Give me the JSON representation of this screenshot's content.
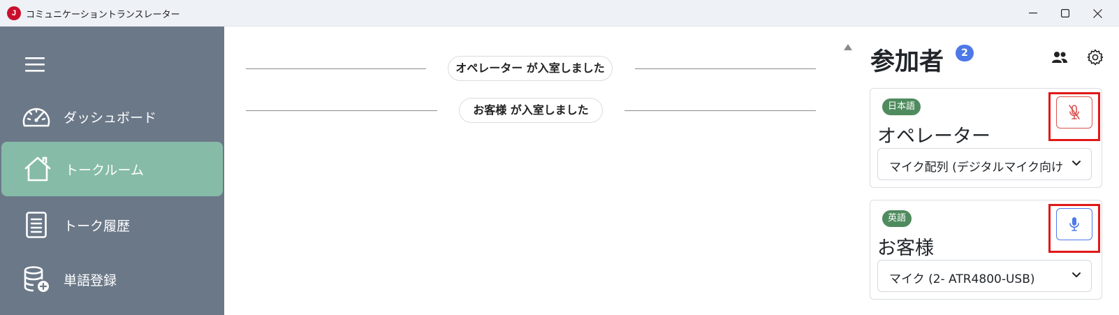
{
  "window": {
    "title": "コミュニケーショントランスレーター",
    "logo_text": "J"
  },
  "sidebar": {
    "items": [
      {
        "label": "ダッシュボード",
        "icon": "gauge-icon",
        "active": false
      },
      {
        "label": "トークルーム",
        "icon": "home-icon",
        "active": true
      },
      {
        "label": "トーク履歴",
        "icon": "document-icon",
        "active": false
      },
      {
        "label": "単語登録",
        "icon": "database-add-icon",
        "active": false
      }
    ],
    "active_color": "#86bba8",
    "background": "#6b7888"
  },
  "chat": {
    "system_messages": [
      {
        "text": "オペレーター が入室しました"
      },
      {
        "text": "お客様 が入室しました"
      }
    ]
  },
  "participants": {
    "title": "参加者",
    "count": "2",
    "cards": [
      {
        "language": "日本語",
        "name": "オペレーター",
        "mic_state": "muted",
        "device": "マイク配列 (デジタルマイク向けインテル® スマート・サウンド・テクノロジー)"
      },
      {
        "language": "英語",
        "name": "お客様",
        "mic_state": "active",
        "device": "マイク (2- ATR4800-USB)"
      }
    ]
  }
}
